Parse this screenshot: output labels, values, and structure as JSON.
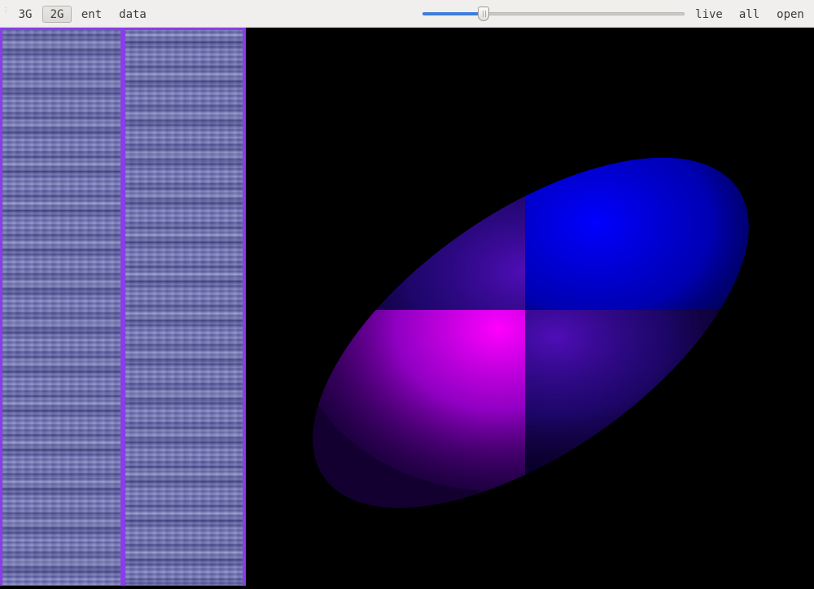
{
  "toolbar": {
    "btn_3g": "3G",
    "btn_2g": "2G",
    "btn_ent": "ent",
    "btn_data": "data",
    "btn_live": "live",
    "btn_all": "all",
    "btn_open": "open",
    "slider_fraction": 0.21
  },
  "colors": {
    "panel_border": "#8a3de8",
    "strip_base": "#7f83bf",
    "blob_blue": "#0000ff",
    "blob_magenta": "#ff00ff",
    "background": "#000000"
  },
  "icons": {
    "grip": "toolbar-grip-icon"
  }
}
